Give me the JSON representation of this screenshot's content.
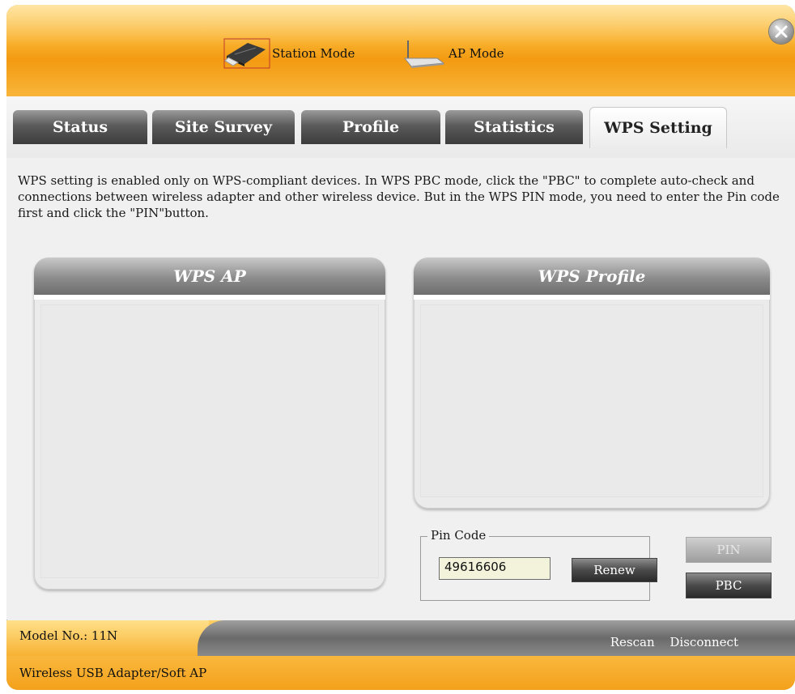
{
  "header": {
    "station_mode_label": "Station Mode",
    "ap_mode_label": "AP Mode",
    "close_icon": "close-icon"
  },
  "tabs": [
    {
      "label": "Status",
      "active": false
    },
    {
      "label": "Site Survey",
      "active": false
    },
    {
      "label": "Profile",
      "active": false
    },
    {
      "label": "Statistics",
      "active": false
    },
    {
      "label": "WPS Setting",
      "active": true
    }
  ],
  "content": {
    "description": "WPS setting is enabled only on WPS-compliant devices. In WPS PBC mode, click the \"PBC\" to complete auto-check and connections between wireless adapter and other wireless device. But in the WPS PIN mode, you need to enter the Pin code first and click the \"PIN\"button.",
    "wps_ap_title": "WPS AP",
    "wps_profile_title": "WPS Profile",
    "pin_code_label": "Pin Code",
    "pin_code_value": "49616606",
    "renew_label": "Renew",
    "pin_button_label": "PIN",
    "pbc_button_label": "PBC"
  },
  "footer": {
    "model_no": "Model No.: 11N",
    "rescan_label": "Rescan",
    "disconnect_label": "Disconnect",
    "adapter_label": "Wireless USB Adapter/Soft AP"
  },
  "colors": {
    "header_orange": "#f39a11",
    "tab_dark": "#3c3c3c",
    "panel_gray": "#8c8c8c",
    "pin_field": "#f3f2da"
  }
}
